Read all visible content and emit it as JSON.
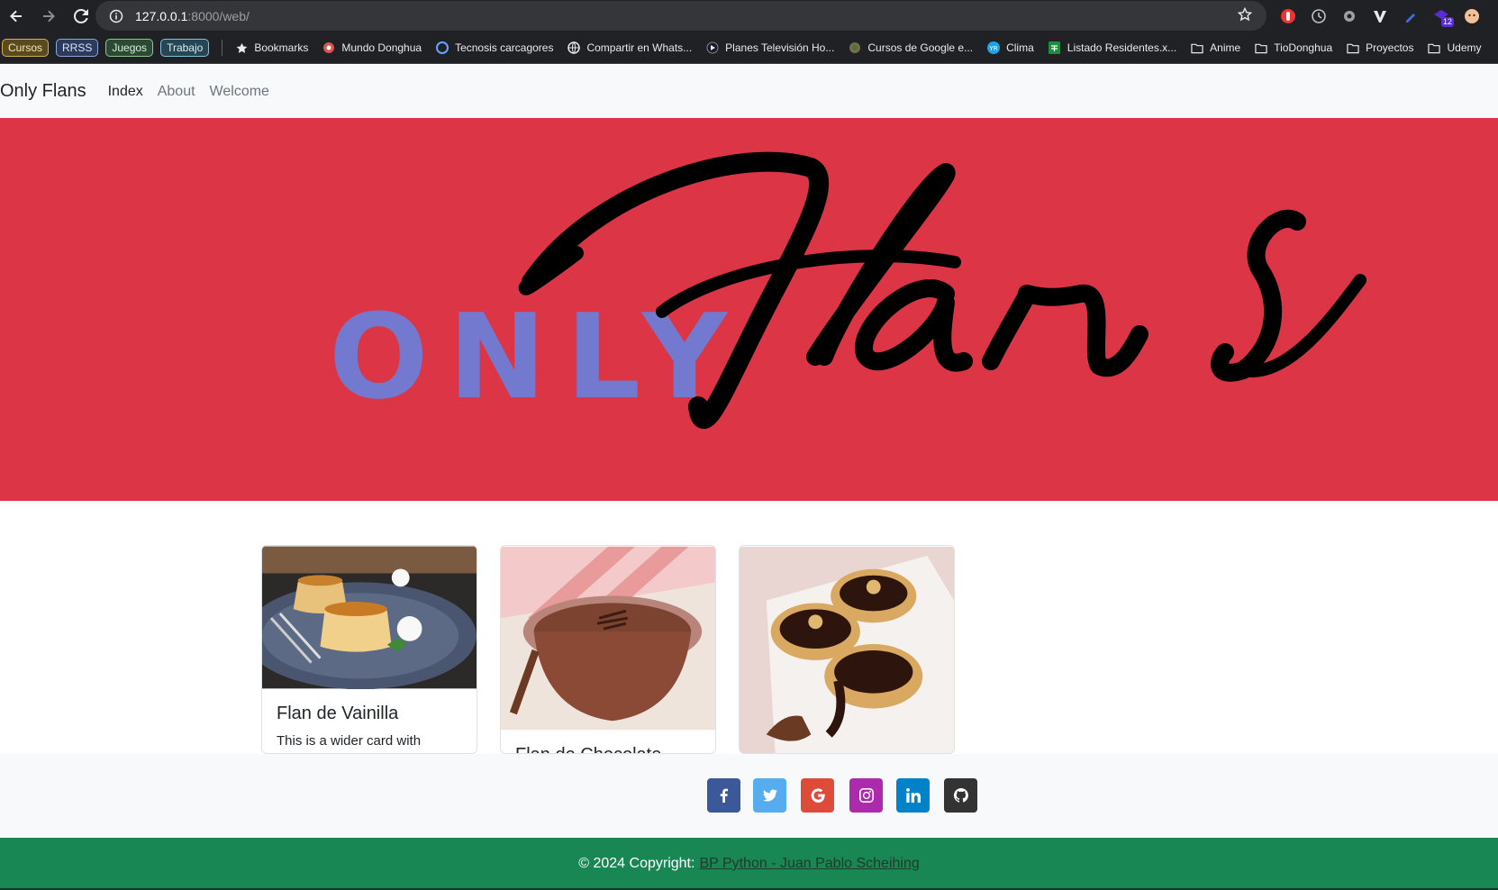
{
  "browser": {
    "url_host": "127.0.0.1",
    "url_path": ":8000/web/",
    "bookmark_chips": [
      "Cursos",
      "RRSS",
      "Juegos",
      "Trabajo"
    ],
    "bookmarks": [
      {
        "label": "Bookmarks",
        "icon": "star-icon"
      },
      {
        "label": "Mundo Donghua",
        "icon": "site-icon"
      },
      {
        "label": "Tecnosis carcagores",
        "icon": "site-icon"
      },
      {
        "label": "Compartir en Whats...",
        "icon": "globe-icon"
      },
      {
        "label": "Planes Televisión Ho...",
        "icon": "play-icon"
      },
      {
        "label": "Cursos de Google e...",
        "icon": "site-icon"
      },
      {
        "label": "Clima",
        "icon": "weather-icon"
      },
      {
        "label": "Listado Residentes.x...",
        "icon": "sheets-icon"
      },
      {
        "label": "Anime",
        "icon": "folder-icon"
      },
      {
        "label": "TioDonghua",
        "icon": "folder-icon"
      },
      {
        "label": "Proyectos",
        "icon": "folder-icon"
      },
      {
        "label": "Udemy",
        "icon": "folder-icon"
      }
    ],
    "extension_badge": "12"
  },
  "navbar": {
    "brand": "Only Flans",
    "links": [
      "Index",
      "About",
      "Welcome"
    ],
    "active": "Index"
  },
  "hero": {
    "word_only": "ONLY",
    "word_flans": "Flans",
    "background": "#dc3545",
    "only_color": "#7479d0"
  },
  "cards": [
    {
      "title": "Flan de Vainilla",
      "text": "This is a wider card with"
    },
    {
      "title": "Flan de Chocolate",
      "text": ""
    },
    {
      "title": "",
      "text": ""
    }
  ],
  "footer": {
    "social": [
      {
        "name": "facebook",
        "color": "#3b5998"
      },
      {
        "name": "twitter",
        "color": "#55acee"
      },
      {
        "name": "google",
        "color": "#dd4b39"
      },
      {
        "name": "instagram",
        "color": "#ac2bac"
      },
      {
        "name": "linkedin",
        "color": "#0082ca"
      },
      {
        "name": "github",
        "color": "#333333"
      }
    ],
    "copyright_prefix": "© 2024 Copyright:",
    "copyright_link": "BP Python - Juan Pablo Scheihing"
  }
}
